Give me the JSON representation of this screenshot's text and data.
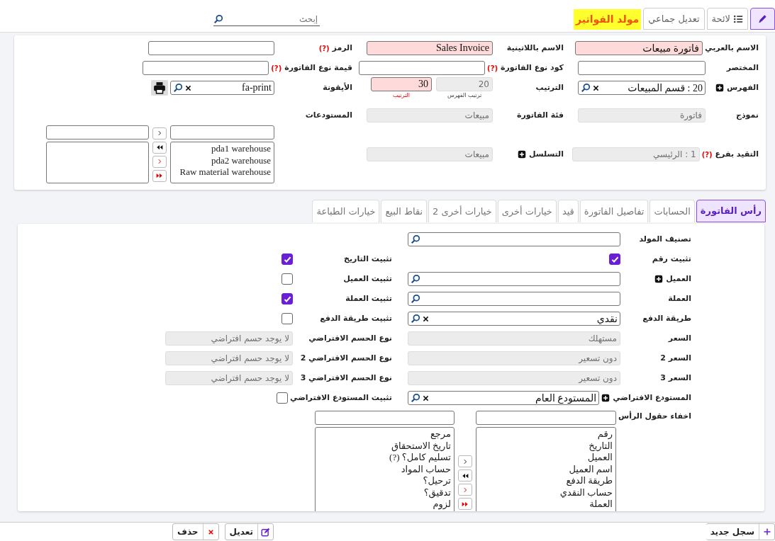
{
  "toolbar": {
    "tabs": [
      {
        "kind": "edit",
        "selected": true
      },
      {
        "kind": "list",
        "label": "لائحة",
        "selected": false
      },
      {
        "kind": "plain",
        "label": "تعديل جماعي",
        "selected": false
      }
    ],
    "title": "مولد الفواتير",
    "search": {
      "placeholder": "إبحث"
    }
  },
  "header": {
    "rows": [
      [
        {
          "kind": "text",
          "label": "الاسم بالعربي",
          "value": "فاتورة مبيعات",
          "required": true
        },
        {
          "kind": "text",
          "label": "الاسم باللاتينية",
          "value": "Sales Invoice",
          "required": true
        },
        {
          "kind": "text",
          "label": "الرمز",
          "help": "(?)"
        }
      ],
      [
        {
          "kind": "text",
          "label": "المختصر"
        },
        {
          "kind": "text",
          "label": "كود نوع الفاتورة",
          "help": "(?)"
        },
        {
          "kind": "text",
          "label": "قيمة نوع الفاتورة",
          "help": "(?)"
        }
      ],
      [
        {
          "kind": "lookup",
          "label": "الفهرس",
          "add": true,
          "value": "20 : قسم المبيعات",
          "clearable": true
        },
        {
          "kind": "pair",
          "label": "الترتيب",
          "fields": [
            {
              "value": "20",
              "sublabel": "ترتيب الفهرس",
              "disabled": true
            },
            {
              "value": "30",
              "sublabel": "الترتيب",
              "required": true
            }
          ]
        },
        {
          "kind": "icon_lookup",
          "label": "الأيقونة",
          "value": "fa-print",
          "clearable": true
        }
      ],
      [
        {
          "kind": "readonly",
          "label": "نموذج",
          "value": "فاتورة"
        },
        {
          "kind": "readonly",
          "label": "فئة الفاتورة",
          "value": "مبيعات"
        },
        {
          "kind": "duallist",
          "label": "المستودعات",
          "items": [
            "pda1 warehouse",
            "pda2 warehouse",
            "Raw material warehouse"
          ]
        }
      ],
      [
        {
          "kind": "readonly",
          "label": "التقيد بفرع",
          "help": "(?)",
          "value": "1 : الرئيسي"
        },
        {
          "kind": "readonly",
          "label": "التسلسل",
          "add": true,
          "value": "مبيعات"
        }
      ]
    ]
  },
  "tabs": [
    {
      "label": "رأس الفاتورة",
      "selected": true
    },
    {
      "label": "الحسابات",
      "selected": false
    },
    {
      "label": "تفاصيل الفاتورة",
      "selected": false
    },
    {
      "label": "قيد",
      "selected": false
    },
    {
      "label": "خيارات أخرى",
      "selected": false
    },
    {
      "label": "خيارات أخرى 2",
      "selected": false
    },
    {
      "label": "نقاط البيع",
      "selected": false
    },
    {
      "label": "خيارات الطباعة",
      "selected": false
    }
  ],
  "body": {
    "rows": [
      [
        {
          "kind": "lookup",
          "label": "تصنيف المولد"
        }
      ],
      [
        {
          "kind": "check",
          "label": "تثبيت رقم",
          "checked": true
        },
        {
          "kind": "check",
          "label": "تثبيت التاريخ",
          "checked": true
        }
      ],
      [
        {
          "kind": "lookup",
          "label": "العميل",
          "add": true
        },
        {
          "kind": "check",
          "label": "تثبيت العميل",
          "checked": false
        }
      ],
      [
        {
          "kind": "lookup",
          "label": "العملة"
        },
        {
          "kind": "check",
          "label": "تثبيت العملة",
          "checked": true
        }
      ],
      [
        {
          "kind": "lookup",
          "label": "طريقة الدفع",
          "value": "نقدي",
          "clearable": true
        },
        {
          "kind": "check",
          "label": "تثبيت طريقة الدفع",
          "checked": false
        }
      ],
      [
        {
          "kind": "readonly",
          "label": "السعر",
          "value": "مستهلك"
        },
        {
          "kind": "readonly",
          "label": "نوع الحسم الافتراضي",
          "value": "لا يوجد حسم افتراضي"
        }
      ],
      [
        {
          "kind": "readonly",
          "label": "السعر 2",
          "value": "دون تسعير"
        },
        {
          "kind": "readonly",
          "label": "نوع الحسم الافتراضي 2",
          "value": "لا يوجد حسم افتراضي"
        }
      ],
      [
        {
          "kind": "readonly",
          "label": "السعر 3",
          "value": "دون تسعير"
        },
        {
          "kind": "readonly",
          "label": "نوع الحسم الافتراضي 3",
          "value": "لا يوجد حسم افتراضي"
        }
      ],
      [
        {
          "kind": "lookup",
          "label": "المستودع الافتراضي",
          "add": true,
          "value": "المستودع العام",
          "clearable": true
        },
        {
          "kind": "check",
          "label": "تثبيت المستودع الافتراضي",
          "checked": false
        }
      ],
      [
        {
          "kind": "duallist",
          "label": "اخفاء حقول الرأس",
          "items": [
            "رقم",
            "التاريخ",
            "العميل",
            "اسم العميل",
            "طريقة الدفع",
            "حساب النقدي",
            "العملة"
          ],
          "other_items": [
            "مرجع",
            "تاريخ الاستحقاق",
            "تسليم كامل؟ (?)",
            "حساب المواد",
            "ترحيل؟",
            "تدقيق؟",
            "لزوم"
          ]
        }
      ]
    ]
  },
  "footer": {
    "buttons": [
      {
        "kind": "new",
        "label": "سجل جديد"
      },
      {
        "kind": "edit",
        "label": "تعديل"
      },
      {
        "kind": "delete",
        "label": "حذف"
      }
    ]
  }
}
